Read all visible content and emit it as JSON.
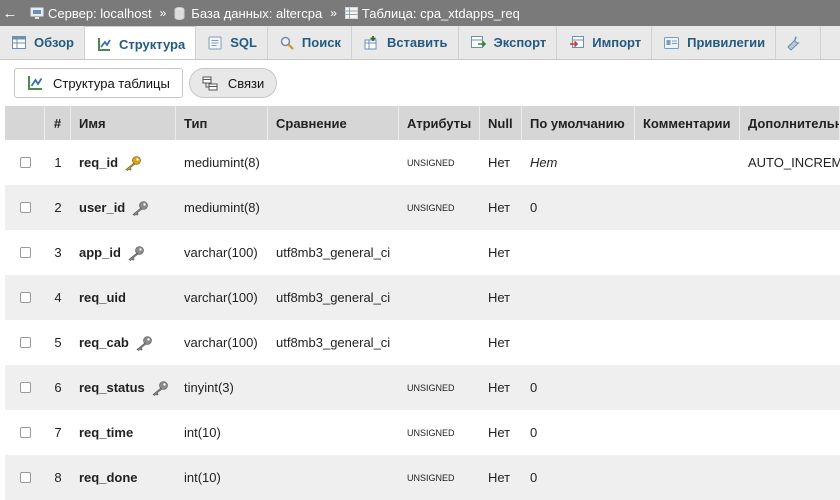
{
  "breadcrumb": {
    "back": "←",
    "server": "Сервер: localhost",
    "database": "База данных: altercpa",
    "table": "Таблица: cpa_xtdapps_req",
    "separator": "»"
  },
  "tabs": [
    {
      "label": "Обзор",
      "icon": "browse-icon",
      "active": false
    },
    {
      "label": "Структура",
      "icon": "structure-icon",
      "active": true
    },
    {
      "label": "SQL",
      "icon": "sql-icon",
      "active": false
    },
    {
      "label": "Поиск",
      "icon": "search-icon",
      "active": false
    },
    {
      "label": "Вставить",
      "icon": "insert-icon",
      "active": false
    },
    {
      "label": "Экспорт",
      "icon": "export-icon",
      "active": false
    },
    {
      "label": "Импорт",
      "icon": "import-icon",
      "active": false
    },
    {
      "label": "Привилегии",
      "icon": "privileges-icon",
      "active": false
    }
  ],
  "subtabs": {
    "structure": "Структура таблицы",
    "relations": "Связи"
  },
  "columns": {
    "num": "#",
    "name": "Имя",
    "type": "Тип",
    "collation": "Сравнение",
    "attributes": "Атрибуты",
    "null": "Null",
    "default": "По умолчанию",
    "comments": "Комментарии",
    "extra": "Дополнительно"
  },
  "rows": [
    {
      "num": "1",
      "name": "req_id",
      "key": "primary",
      "type": "mediumint(8)",
      "collation": "",
      "attributes": "UNSIGNED",
      "null": "Нет",
      "default": "Нет",
      "default_italic": true,
      "comments": "",
      "extra": "AUTO_INCREMENT"
    },
    {
      "num": "2",
      "name": "user_id",
      "key": "index",
      "type": "mediumint(8)",
      "collation": "",
      "attributes": "UNSIGNED",
      "null": "Нет",
      "default": "0",
      "default_italic": false,
      "comments": "",
      "extra": ""
    },
    {
      "num": "3",
      "name": "app_id",
      "key": "index",
      "type": "varchar(100)",
      "collation": "utf8mb3_general_ci",
      "attributes": "",
      "null": "Нет",
      "default": "",
      "default_italic": false,
      "comments": "",
      "extra": ""
    },
    {
      "num": "4",
      "name": "req_uid",
      "key": "",
      "type": "varchar(100)",
      "collation": "utf8mb3_general_ci",
      "attributes": "",
      "null": "Нет",
      "default": "",
      "default_italic": false,
      "comments": "",
      "extra": ""
    },
    {
      "num": "5",
      "name": "req_cab",
      "key": "index",
      "type": "varchar(100)",
      "collation": "utf8mb3_general_ci",
      "attributes": "",
      "null": "Нет",
      "default": "",
      "default_italic": false,
      "comments": "",
      "extra": ""
    },
    {
      "num": "6",
      "name": "req_status",
      "key": "index",
      "type": "tinyint(3)",
      "collation": "",
      "attributes": "UNSIGNED",
      "null": "Нет",
      "default": "0",
      "default_italic": false,
      "comments": "",
      "extra": ""
    },
    {
      "num": "7",
      "name": "req_time",
      "key": "",
      "type": "int(10)",
      "collation": "",
      "attributes": "UNSIGNED",
      "null": "Нет",
      "default": "0",
      "default_italic": false,
      "comments": "",
      "extra": ""
    },
    {
      "num": "8",
      "name": "req_done",
      "key": "",
      "type": "int(10)",
      "collation": "",
      "attributes": "UNSIGNED",
      "null": "Нет",
      "default": "0",
      "default_italic": false,
      "comments": "",
      "extra": ""
    }
  ],
  "colors": {
    "breadcrumb_bg": "#7a7a7a",
    "tab_bg": "#e9e9e9",
    "tab_text": "#235a81",
    "header_bg": "#d6d6d6",
    "row_alt_bg": "#efefef",
    "primary_key": "#e0a400",
    "index_key": "#8a8a8a"
  }
}
